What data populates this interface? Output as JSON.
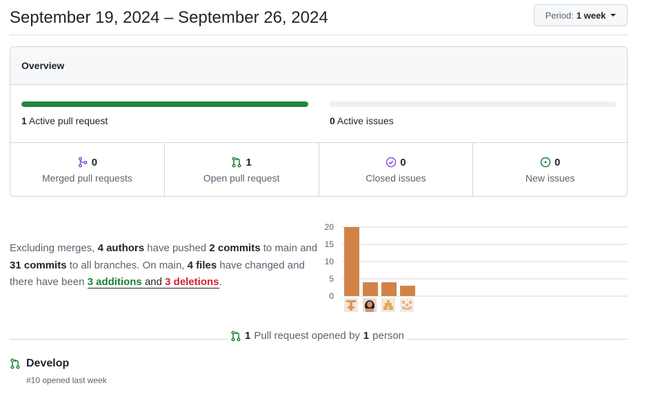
{
  "header": {
    "date_range": "September 19, 2024 – September 26, 2024",
    "period_prefix": "Period:",
    "period_value": "1 week"
  },
  "overview": {
    "title": "Overview",
    "active_prs": {
      "count": "1",
      "label": "Active pull request",
      "fill": 1.0
    },
    "active_issues": {
      "count": "0",
      "label": "Active issues",
      "fill": 0.0
    },
    "stats": [
      {
        "count": "0",
        "label": "Merged pull requests",
        "icon": "git-merge-icon",
        "color": "#8250df"
      },
      {
        "count": "1",
        "label": "Open pull request",
        "icon": "git-pull-request-icon",
        "color": "#1a7f37"
      },
      {
        "count": "0",
        "label": "Closed issues",
        "icon": "issue-closed-icon",
        "color": "#8250df"
      },
      {
        "count": "0",
        "label": "New issues",
        "icon": "issue-opened-icon",
        "color": "#1a7f37"
      }
    ]
  },
  "summary": {
    "t1": "Excluding merges,",
    "authors": "4 authors",
    "t2": "have pushed",
    "commits_main": "2 commits",
    "t3": "to main and",
    "commits_all": "31 commits",
    "t4": "to all branches. On main,",
    "files": "4 files",
    "t5": "have changed and there have been",
    "additions_count": "3",
    "additions_word": "additions",
    "and_word": "and",
    "deletions_count": "3",
    "deletions_word": "deletions",
    "period": "."
  },
  "chart_data": {
    "type": "bar",
    "categories": [
      "contributor-1",
      "contributor-2",
      "contributor-3",
      "contributor-4"
    ],
    "values": [
      20,
      4,
      4,
      3
    ],
    "ylim": [
      0,
      20
    ],
    "yticks": [
      0,
      5,
      10,
      15,
      20
    ],
    "grid": true,
    "bar_color": "#d18347"
  },
  "pr_summary": {
    "count": "1",
    "text1": "Pull request opened by",
    "people": "1",
    "text2": "person"
  },
  "pull_requests": [
    {
      "title": "Develop",
      "meta": "#10 opened last week"
    }
  ],
  "colors": {
    "green": "#1f883d",
    "purple": "#8250df",
    "bar": "#d18347"
  }
}
